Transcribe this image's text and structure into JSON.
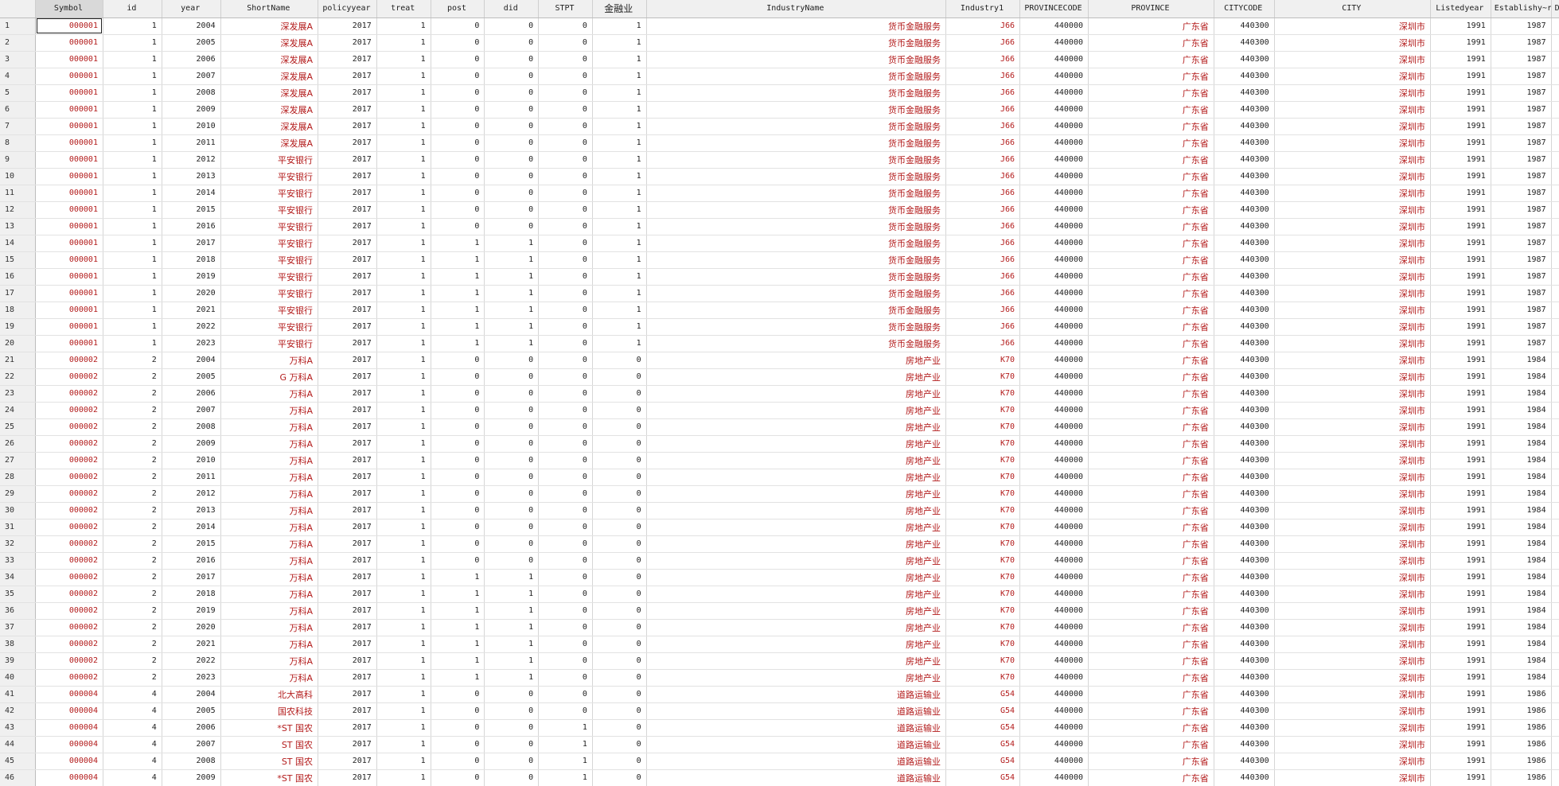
{
  "columns": [
    "Symbol",
    "id",
    "year",
    "ShortName",
    "policyyear",
    "treat",
    "post",
    "did",
    "STPT",
    "金融业",
    "IndustryName",
    "Industry1",
    "PROVINCECODE",
    "PROVINCE",
    "CITYCODE",
    "CITY",
    "Listedyear",
    "Establishy~r",
    "Del"
  ],
  "rows": [
    [
      "000001",
      "1",
      "2004",
      "深发展A",
      "2017",
      "1",
      "0",
      "0",
      "0",
      "1",
      "货币金融服务",
      "J66",
      "440000",
      "广东省",
      "440300",
      "深圳市",
      "1991",
      "1987",
      ""
    ],
    [
      "000001",
      "1",
      "2005",
      "深发展A",
      "2017",
      "1",
      "0",
      "0",
      "0",
      "1",
      "货币金融服务",
      "J66",
      "440000",
      "广东省",
      "440300",
      "深圳市",
      "1991",
      "1987",
      ""
    ],
    [
      "000001",
      "1",
      "2006",
      "深发展A",
      "2017",
      "1",
      "0",
      "0",
      "0",
      "1",
      "货币金融服务",
      "J66",
      "440000",
      "广东省",
      "440300",
      "深圳市",
      "1991",
      "1987",
      ""
    ],
    [
      "000001",
      "1",
      "2007",
      "深发展A",
      "2017",
      "1",
      "0",
      "0",
      "0",
      "1",
      "货币金融服务",
      "J66",
      "440000",
      "广东省",
      "440300",
      "深圳市",
      "1991",
      "1987",
      ""
    ],
    [
      "000001",
      "1",
      "2008",
      "深发展A",
      "2017",
      "1",
      "0",
      "0",
      "0",
      "1",
      "货币金融服务",
      "J66",
      "440000",
      "广东省",
      "440300",
      "深圳市",
      "1991",
      "1987",
      ""
    ],
    [
      "000001",
      "1",
      "2009",
      "深发展A",
      "2017",
      "1",
      "0",
      "0",
      "0",
      "1",
      "货币金融服务",
      "J66",
      "440000",
      "广东省",
      "440300",
      "深圳市",
      "1991",
      "1987",
      ""
    ],
    [
      "000001",
      "1",
      "2010",
      "深发展A",
      "2017",
      "1",
      "0",
      "0",
      "0",
      "1",
      "货币金融服务",
      "J66",
      "440000",
      "广东省",
      "440300",
      "深圳市",
      "1991",
      "1987",
      ""
    ],
    [
      "000001",
      "1",
      "2011",
      "深发展A",
      "2017",
      "1",
      "0",
      "0",
      "0",
      "1",
      "货币金融服务",
      "J66",
      "440000",
      "广东省",
      "440300",
      "深圳市",
      "1991",
      "1987",
      ""
    ],
    [
      "000001",
      "1",
      "2012",
      "平安银行",
      "2017",
      "1",
      "0",
      "0",
      "0",
      "1",
      "货币金融服务",
      "J66",
      "440000",
      "广东省",
      "440300",
      "深圳市",
      "1991",
      "1987",
      ""
    ],
    [
      "000001",
      "1",
      "2013",
      "平安银行",
      "2017",
      "1",
      "0",
      "0",
      "0",
      "1",
      "货币金融服务",
      "J66",
      "440000",
      "广东省",
      "440300",
      "深圳市",
      "1991",
      "1987",
      ""
    ],
    [
      "000001",
      "1",
      "2014",
      "平安银行",
      "2017",
      "1",
      "0",
      "0",
      "0",
      "1",
      "货币金融服务",
      "J66",
      "440000",
      "广东省",
      "440300",
      "深圳市",
      "1991",
      "1987",
      ""
    ],
    [
      "000001",
      "1",
      "2015",
      "平安银行",
      "2017",
      "1",
      "0",
      "0",
      "0",
      "1",
      "货币金融服务",
      "J66",
      "440000",
      "广东省",
      "440300",
      "深圳市",
      "1991",
      "1987",
      ""
    ],
    [
      "000001",
      "1",
      "2016",
      "平安银行",
      "2017",
      "1",
      "0",
      "0",
      "0",
      "1",
      "货币金融服务",
      "J66",
      "440000",
      "广东省",
      "440300",
      "深圳市",
      "1991",
      "1987",
      ""
    ],
    [
      "000001",
      "1",
      "2017",
      "平安银行",
      "2017",
      "1",
      "1",
      "1",
      "0",
      "1",
      "货币金融服务",
      "J66",
      "440000",
      "广东省",
      "440300",
      "深圳市",
      "1991",
      "1987",
      ""
    ],
    [
      "000001",
      "1",
      "2018",
      "平安银行",
      "2017",
      "1",
      "1",
      "1",
      "0",
      "1",
      "货币金融服务",
      "J66",
      "440000",
      "广东省",
      "440300",
      "深圳市",
      "1991",
      "1987",
      ""
    ],
    [
      "000001",
      "1",
      "2019",
      "平安银行",
      "2017",
      "1",
      "1",
      "1",
      "0",
      "1",
      "货币金融服务",
      "J66",
      "440000",
      "广东省",
      "440300",
      "深圳市",
      "1991",
      "1987",
      ""
    ],
    [
      "000001",
      "1",
      "2020",
      "平安银行",
      "2017",
      "1",
      "1",
      "1",
      "0",
      "1",
      "货币金融服务",
      "J66",
      "440000",
      "广东省",
      "440300",
      "深圳市",
      "1991",
      "1987",
      ""
    ],
    [
      "000001",
      "1",
      "2021",
      "平安银行",
      "2017",
      "1",
      "1",
      "1",
      "0",
      "1",
      "货币金融服务",
      "J66",
      "440000",
      "广东省",
      "440300",
      "深圳市",
      "1991",
      "1987",
      ""
    ],
    [
      "000001",
      "1",
      "2022",
      "平安银行",
      "2017",
      "1",
      "1",
      "1",
      "0",
      "1",
      "货币金融服务",
      "J66",
      "440000",
      "广东省",
      "440300",
      "深圳市",
      "1991",
      "1987",
      ""
    ],
    [
      "000001",
      "1",
      "2023",
      "平安银行",
      "2017",
      "1",
      "1",
      "1",
      "0",
      "1",
      "货币金融服务",
      "J66",
      "440000",
      "广东省",
      "440300",
      "深圳市",
      "1991",
      "1987",
      ""
    ],
    [
      "000002",
      "2",
      "2004",
      "万科A",
      "2017",
      "1",
      "0",
      "0",
      "0",
      "0",
      "房地产业",
      "K70",
      "440000",
      "广东省",
      "440300",
      "深圳市",
      "1991",
      "1984",
      ""
    ],
    [
      "000002",
      "2",
      "2005",
      "G 万科A",
      "2017",
      "1",
      "0",
      "0",
      "0",
      "0",
      "房地产业",
      "K70",
      "440000",
      "广东省",
      "440300",
      "深圳市",
      "1991",
      "1984",
      ""
    ],
    [
      "000002",
      "2",
      "2006",
      "万科A",
      "2017",
      "1",
      "0",
      "0",
      "0",
      "0",
      "房地产业",
      "K70",
      "440000",
      "广东省",
      "440300",
      "深圳市",
      "1991",
      "1984",
      ""
    ],
    [
      "000002",
      "2",
      "2007",
      "万科A",
      "2017",
      "1",
      "0",
      "0",
      "0",
      "0",
      "房地产业",
      "K70",
      "440000",
      "广东省",
      "440300",
      "深圳市",
      "1991",
      "1984",
      ""
    ],
    [
      "000002",
      "2",
      "2008",
      "万科A",
      "2017",
      "1",
      "0",
      "0",
      "0",
      "0",
      "房地产业",
      "K70",
      "440000",
      "广东省",
      "440300",
      "深圳市",
      "1991",
      "1984",
      ""
    ],
    [
      "000002",
      "2",
      "2009",
      "万科A",
      "2017",
      "1",
      "0",
      "0",
      "0",
      "0",
      "房地产业",
      "K70",
      "440000",
      "广东省",
      "440300",
      "深圳市",
      "1991",
      "1984",
      ""
    ],
    [
      "000002",
      "2",
      "2010",
      "万科A",
      "2017",
      "1",
      "0",
      "0",
      "0",
      "0",
      "房地产业",
      "K70",
      "440000",
      "广东省",
      "440300",
      "深圳市",
      "1991",
      "1984",
      ""
    ],
    [
      "000002",
      "2",
      "2011",
      "万科A",
      "2017",
      "1",
      "0",
      "0",
      "0",
      "0",
      "房地产业",
      "K70",
      "440000",
      "广东省",
      "440300",
      "深圳市",
      "1991",
      "1984",
      ""
    ],
    [
      "000002",
      "2",
      "2012",
      "万科A",
      "2017",
      "1",
      "0",
      "0",
      "0",
      "0",
      "房地产业",
      "K70",
      "440000",
      "广东省",
      "440300",
      "深圳市",
      "1991",
      "1984",
      ""
    ],
    [
      "000002",
      "2",
      "2013",
      "万科A",
      "2017",
      "1",
      "0",
      "0",
      "0",
      "0",
      "房地产业",
      "K70",
      "440000",
      "广东省",
      "440300",
      "深圳市",
      "1991",
      "1984",
      ""
    ],
    [
      "000002",
      "2",
      "2014",
      "万科A",
      "2017",
      "1",
      "0",
      "0",
      "0",
      "0",
      "房地产业",
      "K70",
      "440000",
      "广东省",
      "440300",
      "深圳市",
      "1991",
      "1984",
      ""
    ],
    [
      "000002",
      "2",
      "2015",
      "万科A",
      "2017",
      "1",
      "0",
      "0",
      "0",
      "0",
      "房地产业",
      "K70",
      "440000",
      "广东省",
      "440300",
      "深圳市",
      "1991",
      "1984",
      ""
    ],
    [
      "000002",
      "2",
      "2016",
      "万科A",
      "2017",
      "1",
      "0",
      "0",
      "0",
      "0",
      "房地产业",
      "K70",
      "440000",
      "广东省",
      "440300",
      "深圳市",
      "1991",
      "1984",
      ""
    ],
    [
      "000002",
      "2",
      "2017",
      "万科A",
      "2017",
      "1",
      "1",
      "1",
      "0",
      "0",
      "房地产业",
      "K70",
      "440000",
      "广东省",
      "440300",
      "深圳市",
      "1991",
      "1984",
      ""
    ],
    [
      "000002",
      "2",
      "2018",
      "万科A",
      "2017",
      "1",
      "1",
      "1",
      "0",
      "0",
      "房地产业",
      "K70",
      "440000",
      "广东省",
      "440300",
      "深圳市",
      "1991",
      "1984",
      ""
    ],
    [
      "000002",
      "2",
      "2019",
      "万科A",
      "2017",
      "1",
      "1",
      "1",
      "0",
      "0",
      "房地产业",
      "K70",
      "440000",
      "广东省",
      "440300",
      "深圳市",
      "1991",
      "1984",
      ""
    ],
    [
      "000002",
      "2",
      "2020",
      "万科A",
      "2017",
      "1",
      "1",
      "1",
      "0",
      "0",
      "房地产业",
      "K70",
      "440000",
      "广东省",
      "440300",
      "深圳市",
      "1991",
      "1984",
      ""
    ],
    [
      "000002",
      "2",
      "2021",
      "万科A",
      "2017",
      "1",
      "1",
      "1",
      "0",
      "0",
      "房地产业",
      "K70",
      "440000",
      "广东省",
      "440300",
      "深圳市",
      "1991",
      "1984",
      ""
    ],
    [
      "000002",
      "2",
      "2022",
      "万科A",
      "2017",
      "1",
      "1",
      "1",
      "0",
      "0",
      "房地产业",
      "K70",
      "440000",
      "广东省",
      "440300",
      "深圳市",
      "1991",
      "1984",
      ""
    ],
    [
      "000002",
      "2",
      "2023",
      "万科A",
      "2017",
      "1",
      "1",
      "1",
      "0",
      "0",
      "房地产业",
      "K70",
      "440000",
      "广东省",
      "440300",
      "深圳市",
      "1991",
      "1984",
      ""
    ],
    [
      "000004",
      "4",
      "2004",
      "北大高科",
      "2017",
      "1",
      "0",
      "0",
      "0",
      "0",
      "道路运输业",
      "G54",
      "440000",
      "广东省",
      "440300",
      "深圳市",
      "1991",
      "1986",
      ""
    ],
    [
      "000004",
      "4",
      "2005",
      "国农科技",
      "2017",
      "1",
      "0",
      "0",
      "0",
      "0",
      "道路运输业",
      "G54",
      "440000",
      "广东省",
      "440300",
      "深圳市",
      "1991",
      "1986",
      ""
    ],
    [
      "000004",
      "4",
      "2006",
      "*ST 国农",
      "2017",
      "1",
      "0",
      "0",
      "1",
      "0",
      "道路运输业",
      "G54",
      "440000",
      "广东省",
      "440300",
      "深圳市",
      "1991",
      "1986",
      ""
    ],
    [
      "000004",
      "4",
      "2007",
      "ST 国农",
      "2017",
      "1",
      "0",
      "0",
      "1",
      "0",
      "道路运输业",
      "G54",
      "440000",
      "广东省",
      "440300",
      "深圳市",
      "1991",
      "1986",
      ""
    ],
    [
      "000004",
      "4",
      "2008",
      "ST 国农",
      "2017",
      "1",
      "0",
      "0",
      "1",
      "0",
      "道路运输业",
      "G54",
      "440000",
      "广东省",
      "440300",
      "深圳市",
      "1991",
      "1986",
      ""
    ],
    [
      "000004",
      "4",
      "2009",
      "*ST 国农",
      "2017",
      "1",
      "0",
      "0",
      "1",
      "0",
      "道路运输业",
      "G54",
      "440000",
      "广东省",
      "440300",
      "深圳市",
      "1991",
      "1986",
      ""
    ]
  ]
}
